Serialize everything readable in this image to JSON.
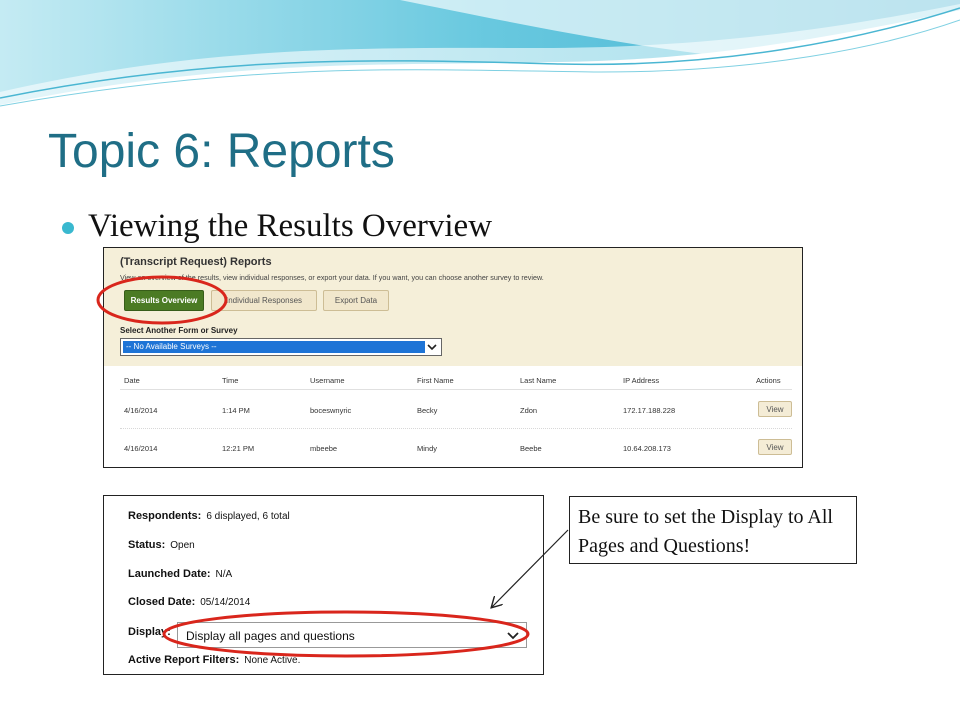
{
  "slide": {
    "title": "Topic 6:  Reports",
    "bullet": "Viewing the Results Overview",
    "colors": {
      "title": "#1f6e86",
      "bullet": "#39b8cf",
      "highlight_ring": "#d9261c"
    }
  },
  "reports_panel": {
    "title": "(Transcript Request) Reports",
    "description": "View an overview of the results, view individual responses, or export your data. If you want, you can choose another survey to review.",
    "buttons": {
      "results_overview": "Results Overview",
      "individual_responses": "Individual Responses",
      "export_data": "Export Data"
    },
    "select_label": "Select Another Form or Survey",
    "select_value": "-- No Available Surveys --",
    "table": {
      "headers": [
        "Date",
        "Time",
        "Username",
        "First Name",
        "Last Name",
        "IP Address",
        "Actions"
      ],
      "rows": [
        {
          "date": "4/16/2014",
          "time": "1:14 PM",
          "username": "boceswnyric",
          "first_name": "Becky",
          "last_name": "Zdon",
          "ip": "172.17.188.228",
          "action": "View"
        },
        {
          "date": "4/16/2014",
          "time": "12:21 PM",
          "username": "mbeebe",
          "first_name": "Mindy",
          "last_name": "Beebe",
          "ip": "10.64.208.173",
          "action": "View"
        }
      ]
    }
  },
  "overview_panel": {
    "respondents_label": "Respondents:",
    "respondents_value": "6 displayed, 6 total",
    "status_label": "Status:",
    "status_value": "Open",
    "launched_label": "Launched Date:",
    "launched_value": "N/A",
    "closed_label": "Closed Date:",
    "closed_value": "05/14/2014",
    "display_label": "Display:",
    "display_value": "Display all pages and questions",
    "filters_label": "Active Report Filters:",
    "filters_value": "None Active."
  },
  "callout": {
    "text": "Be sure to set the Display to All Pages and Questions!"
  },
  "icons": {
    "select_chevron": "chevron-down-icon",
    "display_chevron": "chevron-down-icon",
    "pointer_arrow": "arrow-icon"
  }
}
